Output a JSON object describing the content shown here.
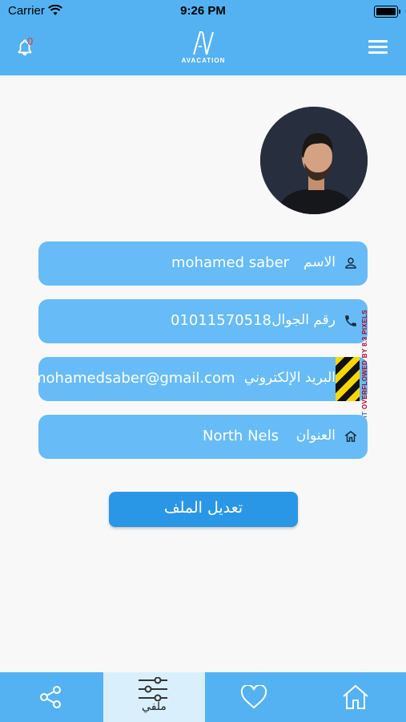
{
  "status_bar": {
    "carrier": "Carrier",
    "time": "9:26 PM"
  },
  "header": {
    "notification_count": "0",
    "logo_text": "AVACATION"
  },
  "profile": {
    "fields": [
      {
        "label": "الاسم",
        "value": "mohamed saber",
        "icon": "person-icon"
      },
      {
        "label": "رقم الجوال",
        "value": "01011570518",
        "icon": "phone-icon"
      },
      {
        "label": "البريد الإلكتروني",
        "value": "mohamedsaber@gmail.com",
        "icon": "email-icon"
      },
      {
        "label": "العنوان",
        "value": "North Nels",
        "icon": "home-icon"
      }
    ],
    "edit_button_label": "تعديل الملف",
    "overflow_warning": {
      "prefix": "RIGHT",
      "text": "OVERFLOWED BY 8.3 PIXELS"
    }
  },
  "bottom_nav": {
    "items": [
      {
        "icon": "share-icon",
        "label": ""
      },
      {
        "icon": "sliders-icon",
        "label": "ملفي",
        "active": true
      },
      {
        "icon": "heart-icon",
        "label": ""
      },
      {
        "icon": "home-icon",
        "label": ""
      }
    ]
  },
  "colors": {
    "primary": "#54b2f2",
    "field_bg": "#67bcf8",
    "button": "#2a97e6",
    "active_tab": "#d9f0fc",
    "background": "#f8f8f8"
  }
}
